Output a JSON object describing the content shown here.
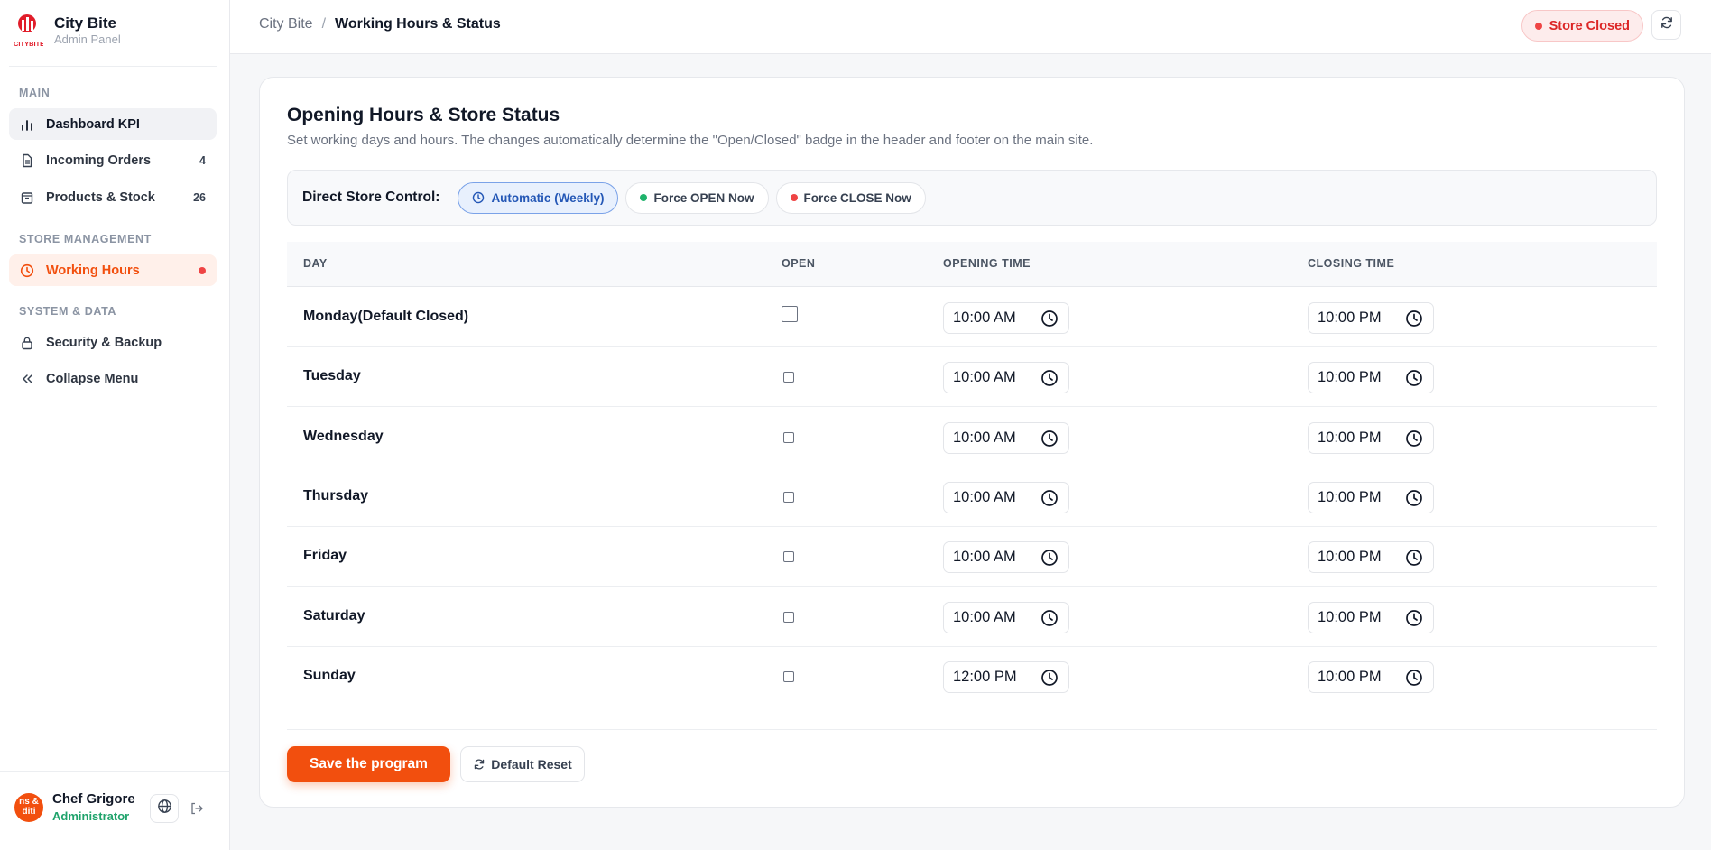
{
  "brand": {
    "name": "City Bite",
    "subtitle": "Admin Panel",
    "logo_text": "CITYBITE"
  },
  "sidebar": {
    "sections": {
      "main": "MAIN",
      "store_management": "STORE MANAGEMENT",
      "system_data": "SYSTEM & DATA"
    },
    "items": [
      {
        "label": "Dashboard KPI",
        "icon": "bar-chart-icon"
      },
      {
        "label": "Incoming Orders",
        "icon": "document-icon",
        "count": "4"
      },
      {
        "label": "Products & Stock",
        "icon": "package-icon",
        "count": "26"
      },
      {
        "label": "Working Hours",
        "icon": "clock-icon"
      },
      {
        "label": "Security & Backup",
        "icon": "lock-icon"
      },
      {
        "label": "Collapse Menu",
        "icon": "double-chevron-left-icon"
      }
    ]
  },
  "user": {
    "name": "Chef Grigore",
    "role": "Administrator",
    "avatar_text": "ns & diti"
  },
  "header": {
    "breadcrumb_root": "City Bite",
    "breadcrumb_separator": "/",
    "breadcrumb_current": "Working Hours & Status",
    "store_status": "Store Closed"
  },
  "main": {
    "title": "Opening Hours & Store Status",
    "subtitle": "Set working days and hours. The changes automatically determine the \"Open/Closed\" badge in the header and footer on the main site.",
    "control_label": "Direct Store Control:",
    "controls": {
      "automatic": "Automatic (Weekly)",
      "force_open": "Force OPEN Now",
      "force_close": "Force CLOSE Now"
    },
    "columns": {
      "day": "DAY",
      "open": "OPEN",
      "opening_time": "OPENING TIME",
      "closing_time": "CLOSING TIME"
    },
    "rows": [
      {
        "day": "Monday(Default Closed)",
        "open": false,
        "opening": "10:00 AM",
        "closing": "10:00 PM"
      },
      {
        "day": "Tuesday",
        "open": false,
        "opening": "10:00 AM",
        "closing": "10:00 PM"
      },
      {
        "day": "Wednesday",
        "open": false,
        "opening": "10:00 AM",
        "closing": "10:00 PM"
      },
      {
        "day": "Thursday",
        "open": false,
        "opening": "10:00 AM",
        "closing": "10:00 PM"
      },
      {
        "day": "Friday",
        "open": false,
        "opening": "10:00 AM",
        "closing": "10:00 PM"
      },
      {
        "day": "Saturday",
        "open": false,
        "opening": "10:00 AM",
        "closing": "10:00 PM"
      },
      {
        "day": "Sunday",
        "open": false,
        "opening": "12:00 PM",
        "closing": "10:00 PM"
      }
    ],
    "save_label": "Save the program",
    "reset_label": "Default Reset"
  },
  "colors": {
    "accent": "#f24f0e",
    "closed_red": "#dc2626",
    "open_green": "#1fa36b",
    "auto_blue": "#2457b6"
  }
}
